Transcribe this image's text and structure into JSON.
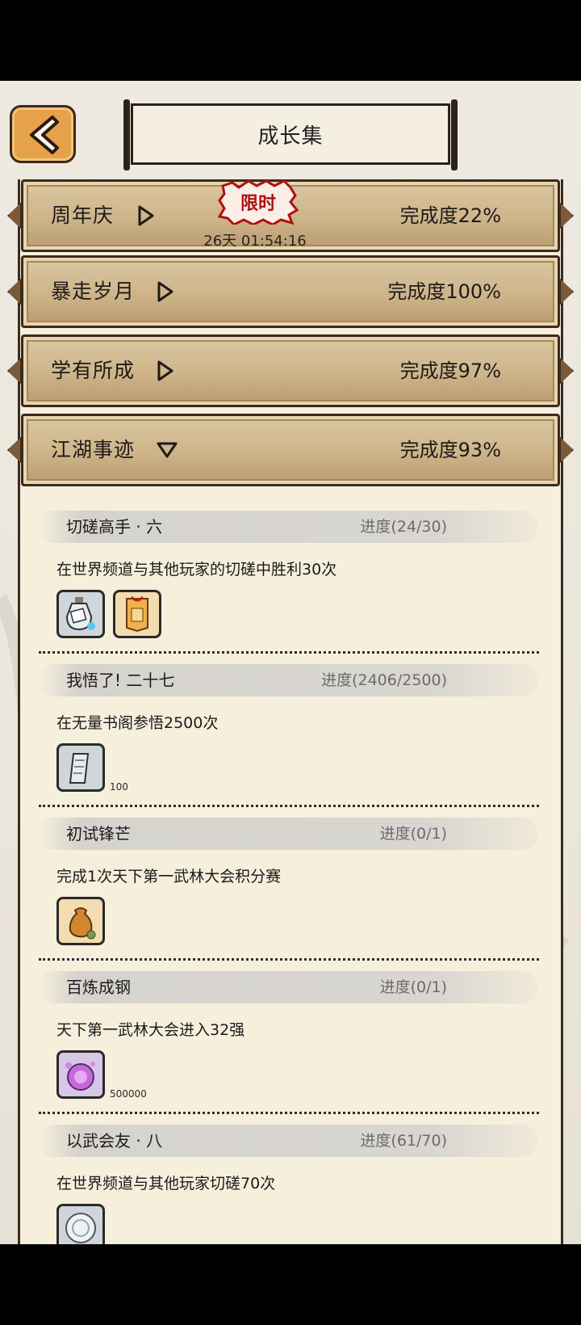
{
  "header": {
    "title": "成长集"
  },
  "sections": [
    {
      "name": "周年庆",
      "progress": "完成度22%",
      "state": "collapsed",
      "badge": "限时",
      "countdown": "26天 01:54:16"
    },
    {
      "name": "暴走岁月",
      "progress": "完成度100%",
      "state": "collapsed"
    },
    {
      "name": "学有所成",
      "progress": "完成度97%",
      "state": "collapsed"
    },
    {
      "name": "江湖事迹",
      "progress": "完成度93%",
      "state": "expanded"
    }
  ],
  "tasks": [
    {
      "title": "切磋高手 · 六",
      "progress": "进度(24/30)",
      "desc": "在世界频道与其他玩家的切磋中胜利30次",
      "rewards": [
        {
          "icon": "potion-bottle-icon"
        },
        {
          "icon": "token-card-icon"
        }
      ]
    },
    {
      "title": "我悟了! 二十七",
      "progress": "进度(2406/2500)",
      "desc": "在无量书阁参悟2500次",
      "rewards": [
        {
          "icon": "paper-scroll-icon",
          "count": "100"
        }
      ]
    },
    {
      "title": "初试锋芒",
      "progress": "进度(0/1)",
      "desc": "完成1次天下第一武林大会积分赛",
      "rewards": [
        {
          "icon": "money-pouch-icon"
        }
      ]
    },
    {
      "title": "百炼成钢",
      "progress": "进度(0/1)",
      "desc": "天下第一武林大会进入32强",
      "rewards": [
        {
          "icon": "purple-orb-icon",
          "count": "500000"
        }
      ]
    },
    {
      "title": "以武会友 · 八",
      "progress": "进度(61/70)",
      "desc": "在世界频道与其他玩家切磋70次",
      "rewards": [
        {
          "icon": "silver-coin-icon"
        }
      ]
    }
  ],
  "colors": {
    "accent_orange": "#e6a24a",
    "section_bar": "#cdb48a",
    "limited_red": "#b01010",
    "paper": "#f6efdc"
  }
}
